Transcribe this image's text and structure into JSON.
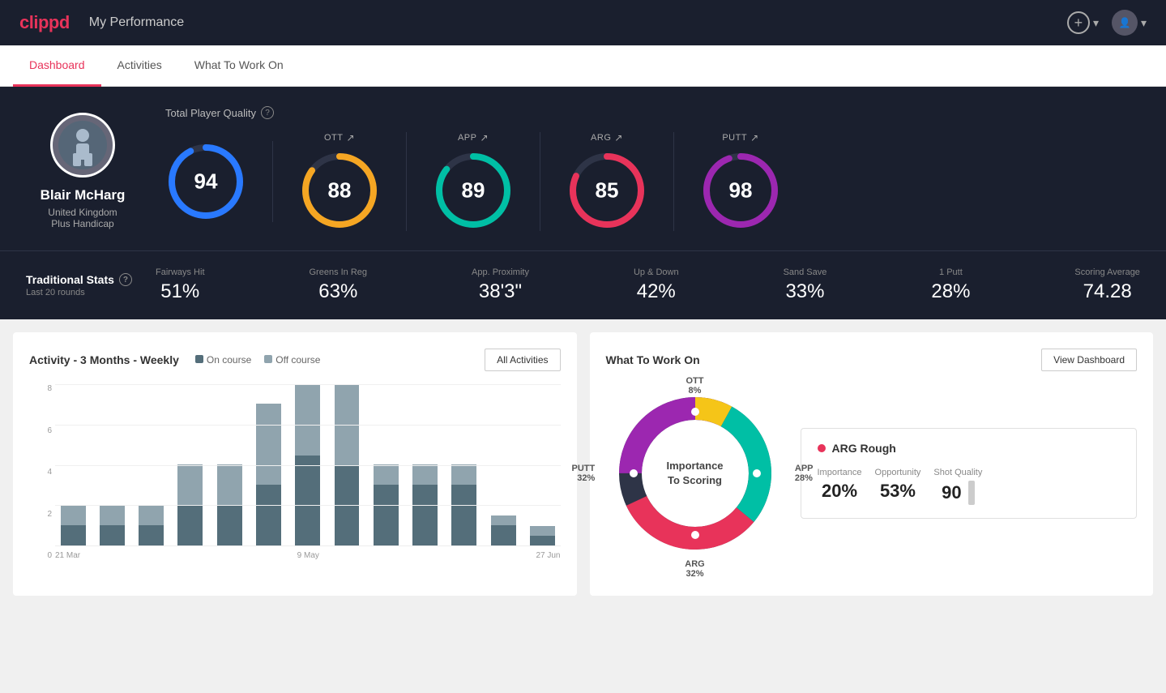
{
  "header": {
    "logo": "clippd",
    "title": "My Performance",
    "add_label": "+",
    "chevron": "▾"
  },
  "nav": {
    "tabs": [
      {
        "label": "Dashboard",
        "active": true
      },
      {
        "label": "Activities",
        "active": false
      },
      {
        "label": "What To Work On",
        "active": false
      }
    ]
  },
  "player": {
    "name": "Blair McHarg",
    "country": "United Kingdom",
    "handicap": "Plus Handicap",
    "avatar_emoji": "🧑"
  },
  "quality": {
    "label": "Total Player Quality",
    "metrics": [
      {
        "id": "total",
        "value": "94",
        "color": "#2979ff",
        "bg": "#1a1f2e",
        "track": "#2979ff",
        "show_label": false
      },
      {
        "id": "ott",
        "label": "OTT",
        "value": "88",
        "color": "#f5a623",
        "track_color": "#f5a623"
      },
      {
        "id": "app",
        "label": "APP",
        "value": "89",
        "color": "#00bfa5",
        "track_color": "#00bfa5"
      },
      {
        "id": "arg",
        "label": "ARG",
        "value": "85",
        "color": "#e8335a",
        "track_color": "#e8335a"
      },
      {
        "id": "putt",
        "label": "PUTT",
        "value": "98",
        "color": "#9c27b0",
        "track_color": "#9c27b0"
      }
    ]
  },
  "traditional_stats": {
    "label": "Traditional Stats",
    "sublabel": "Last 20 rounds",
    "stats": [
      {
        "label": "Fairways Hit",
        "value": "51%"
      },
      {
        "label": "Greens In Reg",
        "value": "63%"
      },
      {
        "label": "App. Proximity",
        "value": "38'3\""
      },
      {
        "label": "Up & Down",
        "value": "42%"
      },
      {
        "label": "Sand Save",
        "value": "33%"
      },
      {
        "label": "1 Putt",
        "value": "28%"
      },
      {
        "label": "Scoring Average",
        "value": "74.28"
      }
    ]
  },
  "activity_chart": {
    "title": "Activity - 3 Months - Weekly",
    "legend_on": "On course",
    "legend_off": "Off course",
    "all_activities_btn": "All Activities",
    "y_labels": [
      "8",
      "6",
      "4",
      "2",
      "0"
    ],
    "x_labels": [
      "21 Mar",
      "9 May",
      "27 Jun"
    ],
    "bars": [
      {
        "on": 1,
        "off": 1
      },
      {
        "on": 1,
        "off": 1
      },
      {
        "on": 1,
        "off": 1
      },
      {
        "on": 2,
        "off": 2
      },
      {
        "on": 2,
        "off": 2
      },
      {
        "on": 3,
        "off": 4
      },
      {
        "on": 5,
        "off": 4
      },
      {
        "on": 4,
        "off": 4
      },
      {
        "on": 3,
        "off": 1
      },
      {
        "on": 3,
        "off": 1
      },
      {
        "on": 3,
        "off": 1
      },
      {
        "on": 1,
        "off": 0.5
      },
      {
        "on": 0.5,
        "off": 0.5
      }
    ]
  },
  "what_to_work_on": {
    "title": "What To Work On",
    "view_dashboard_btn": "View Dashboard",
    "donut_center": "Importance\nTo Scoring",
    "segments": [
      {
        "label": "OTT",
        "value": "8%",
        "color": "#f5c518"
      },
      {
        "label": "APP",
        "value": "28%",
        "color": "#00bfa5"
      },
      {
        "label": "ARG",
        "value": "32%",
        "color": "#e8335a"
      },
      {
        "label": "PUTT",
        "value": "32%",
        "color": "#9c27b0"
      }
    ],
    "info_card": {
      "title": "ARG Rough",
      "importance_label": "Importance",
      "importance_value": "20%",
      "opportunity_label": "Opportunity",
      "opportunity_value": "53%",
      "shot_quality_label": "Shot Quality",
      "shot_quality_value": "90"
    }
  }
}
